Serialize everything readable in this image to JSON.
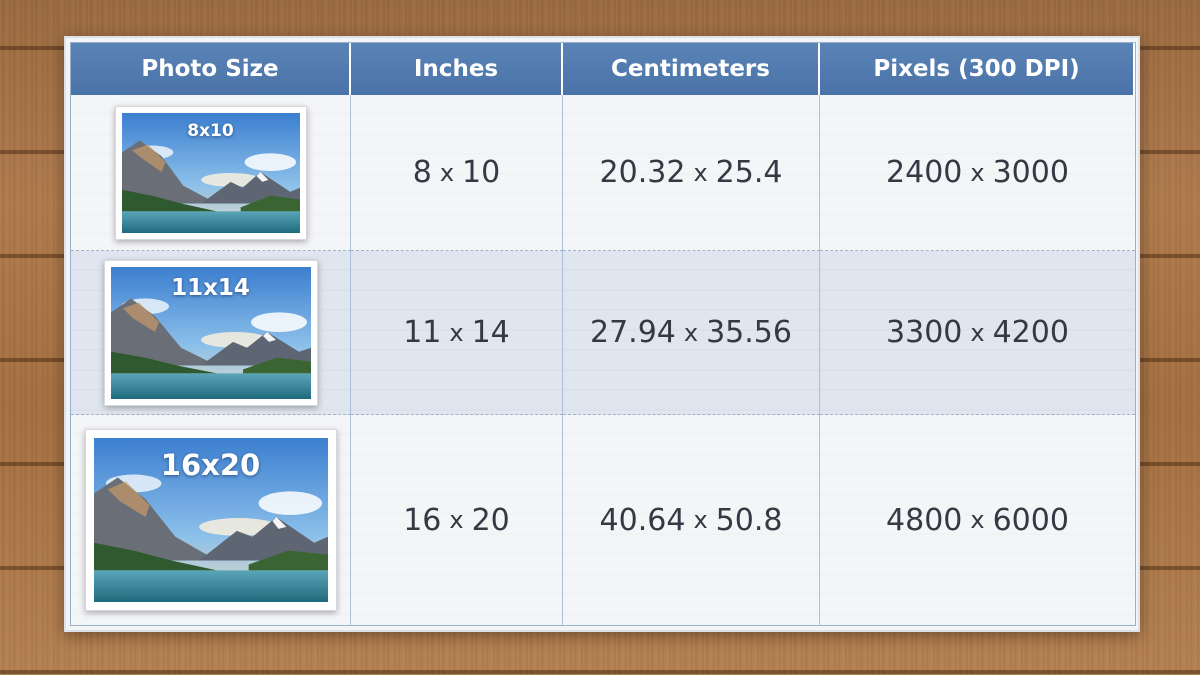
{
  "table": {
    "headers": [
      "Photo Size",
      "Inches",
      "Centimeters",
      "Pixels (300 DPI)"
    ],
    "rows": [
      {
        "photo_label": "8x10",
        "inches": [
          "8",
          "10"
        ],
        "centimeters": [
          "20.32",
          "25.4"
        ],
        "pixels": [
          "2400",
          "3000"
        ]
      },
      {
        "photo_label": "11x14",
        "inches": [
          "11",
          "14"
        ],
        "centimeters": [
          "27.94",
          "35.56"
        ],
        "pixels": [
          "3300",
          "4200"
        ]
      },
      {
        "photo_label": "16x20",
        "inches": [
          "16",
          "20"
        ],
        "centimeters": [
          "40.64",
          "50.8"
        ],
        "pixels": [
          "4800",
          "6000"
        ]
      }
    ],
    "times_symbol": "x"
  },
  "colors": {
    "header_bg": "#4f78ad",
    "header_text": "#ffffff",
    "row_alt_bg": "#dfe6ef",
    "wood": "#a8744a"
  },
  "icons": {
    "thumbnail": "mountain-lake-photo"
  }
}
